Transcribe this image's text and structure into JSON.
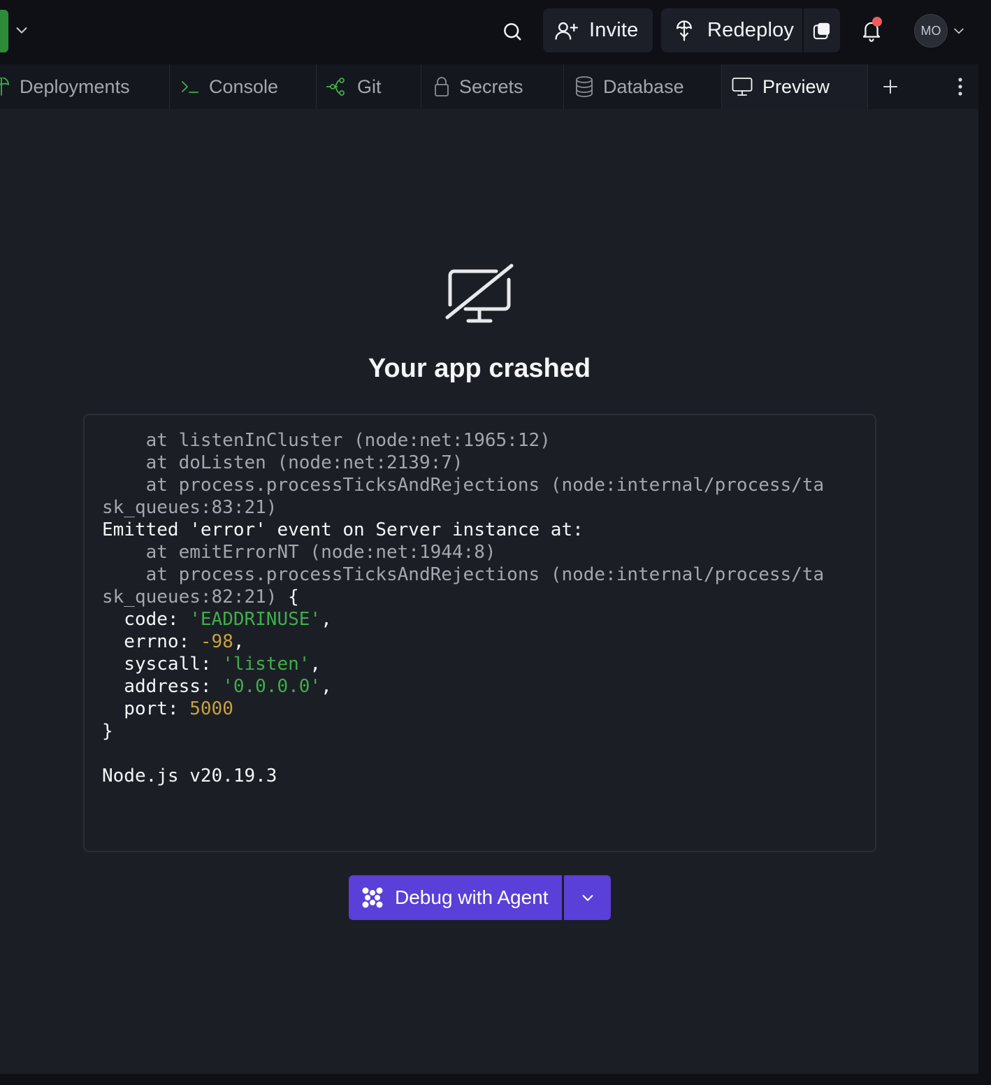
{
  "topbar": {
    "search_icon": "search-icon",
    "invite_label": "Invite",
    "redeploy_label": "Redeploy",
    "avatar_initials": "MO",
    "notification_dot_color": "#f05b5b",
    "project_color": "#2e8b3a"
  },
  "tabs": [
    {
      "label": "Deployments",
      "icon": "deployments-icon",
      "active": false
    },
    {
      "label": "Console",
      "icon": "terminal-icon",
      "active": false
    },
    {
      "label": "Git",
      "icon": "git-icon",
      "active": false
    },
    {
      "label": "Secrets",
      "icon": "lock-icon",
      "active": false
    },
    {
      "label": "Database",
      "icon": "database-icon",
      "active": false
    },
    {
      "label": "Preview",
      "icon": "monitor-icon",
      "active": true
    }
  ],
  "preview": {
    "title": "Your app crashed",
    "log_lines": [
      "    at listenInCluster (node:net:1965:12)",
      "    at doListen (node:net:2139:7)",
      "    at process.processTicksAndRejections (node:internal/process/ta",
      "sk_queues:83:21)",
      "Emitted 'error' event on Server instance at:",
      "    at emitErrorNT (node:net:1944:8)",
      "    at process.processTicksAndRejections (node:internal/process/ta",
      "sk_queues:82:21) {",
      "  code: 'EADDRINUSE',",
      "  errno: -98,",
      "  syscall: 'listen',",
      "  address: '0.0.0.0',",
      "  port: 5000",
      "}",
      "",
      "Node.js v20.19.3"
    ],
    "debug_button_label": "Debug with Agent",
    "accent_color": "#5a3fd8"
  }
}
